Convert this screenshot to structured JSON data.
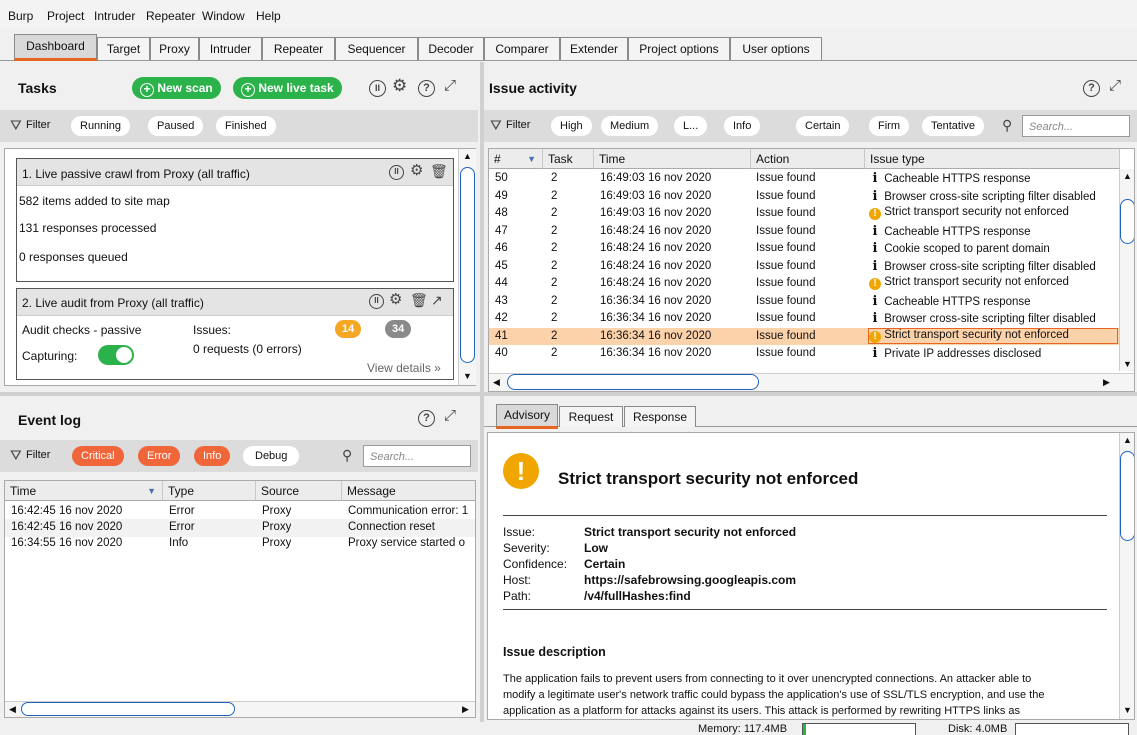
{
  "menu": [
    "Burp",
    "Project",
    "Intruder",
    "Repeater",
    "Window",
    "Help"
  ],
  "tabs": [
    "Dashboard",
    "Target",
    "Proxy",
    "Intruder",
    "Repeater",
    "Sequencer",
    "Decoder",
    "Comparer",
    "Extender",
    "Project options",
    "User options"
  ],
  "tasks": {
    "title": "Tasks",
    "new_scan": "New scan",
    "new_live_task": "New live task",
    "filter_label": "Filter",
    "filters": [
      "Running",
      "Paused",
      "Finished"
    ],
    "task1": {
      "title": "1. Live passive crawl from Proxy (all traffic)",
      "lines": [
        "582 items added to site map",
        "131 responses processed",
        "0 responses queued"
      ]
    },
    "task2": {
      "title": "2. Live audit from Proxy (all traffic)",
      "audit_checks": "Audit checks - passive",
      "issues_label": "Issues:",
      "issues_orange": "14",
      "issues_gray": "34",
      "requests": "0 requests (0 errors)",
      "capturing_label": "Capturing:",
      "view_details": "View details"
    }
  },
  "issue_activity": {
    "title": "Issue activity",
    "filter_label": "Filter",
    "filters": [
      "High",
      "Medium",
      "L...",
      "Info",
      "Certain",
      "Firm",
      "Tentative"
    ],
    "search_placeholder": "Search...",
    "columns": [
      "#",
      "Task",
      "Time",
      "Action",
      "Issue type"
    ],
    "rows": [
      {
        "num": "50",
        "task": "2",
        "time": "16:49:03 16 nov 2020",
        "action": "Issue found",
        "icon": "info",
        "type": "Cacheable HTTPS response"
      },
      {
        "num": "49",
        "task": "2",
        "time": "16:49:03 16 nov 2020",
        "action": "Issue found",
        "icon": "info",
        "type": "Browser cross-site scripting filter disabled"
      },
      {
        "num": "48",
        "task": "2",
        "time": "16:49:03 16 nov 2020",
        "action": "Issue found",
        "icon": "warn",
        "type": "Strict transport security not enforced"
      },
      {
        "num": "47",
        "task": "2",
        "time": "16:48:24 16 nov 2020",
        "action": "Issue found",
        "icon": "info",
        "type": "Cacheable HTTPS response"
      },
      {
        "num": "46",
        "task": "2",
        "time": "16:48:24 16 nov 2020",
        "action": "Issue found",
        "icon": "info",
        "type": "Cookie scoped to parent domain"
      },
      {
        "num": "45",
        "task": "2",
        "time": "16:48:24 16 nov 2020",
        "action": "Issue found",
        "icon": "info",
        "type": "Browser cross-site scripting filter disabled"
      },
      {
        "num": "44",
        "task": "2",
        "time": "16:48:24 16 nov 2020",
        "action": "Issue found",
        "icon": "warn",
        "type": "Strict transport security not enforced"
      },
      {
        "num": "43",
        "task": "2",
        "time": "16:36:34 16 nov 2020",
        "action": "Issue found",
        "icon": "info",
        "type": "Cacheable HTTPS response"
      },
      {
        "num": "42",
        "task": "2",
        "time": "16:36:34 16 nov 2020",
        "action": "Issue found",
        "icon": "info",
        "type": "Browser cross-site scripting filter disabled"
      },
      {
        "num": "41",
        "task": "2",
        "time": "16:36:34 16 nov 2020",
        "action": "Issue found",
        "icon": "warn",
        "type": "Strict transport security not enforced",
        "selected": true
      },
      {
        "num": "40",
        "task": "2",
        "time": "16:36:34 16 nov 2020",
        "action": "Issue found",
        "icon": "info",
        "type": "Private IP addresses disclosed"
      }
    ]
  },
  "event_log": {
    "title": "Event log",
    "filter_label": "Filter",
    "filters": [
      "Critical",
      "Error",
      "Info",
      "Debug"
    ],
    "search_placeholder": "Search...",
    "columns": [
      "Time",
      "Type",
      "Source",
      "Message"
    ],
    "rows": [
      {
        "time": "16:42:45 16 nov 2020",
        "type": "Error",
        "source": "Proxy",
        "message": "Communication error: 1"
      },
      {
        "time": "16:42:45 16 nov 2020",
        "type": "Error",
        "source": "Proxy",
        "message": "Connection reset"
      },
      {
        "time": "16:34:55 16 nov 2020",
        "type": "Info",
        "source": "Proxy",
        "message": "Proxy service started o"
      }
    ]
  },
  "advisory": {
    "tabs": [
      "Advisory",
      "Request",
      "Response"
    ],
    "heading": "Strict transport security not enforced",
    "fields": [
      {
        "label": "Issue:",
        "value": "Strict transport security not enforced"
      },
      {
        "label": "Severity:",
        "value": "Low"
      },
      {
        "label": "Confidence:",
        "value": "Certain"
      },
      {
        "label": "Host:",
        "value": "https://safebrowsing.googleapis.com"
      },
      {
        "label": "Path:",
        "value": "/v4/fullHashes:find"
      }
    ],
    "section_title": "Issue description",
    "description_lines": [
      "The application fails to prevent users from connecting to it over unencrypted connections. An attacker able to",
      "modify a legitimate user's network traffic could bypass the application's use of SSL/TLS encryption, and use the",
      "application as a platform for attacks against its users. This attack is performed by rewriting HTTPS links as"
    ]
  },
  "status": {
    "memory": "Memory: 117.4MB",
    "memory_fraction": 0.03,
    "disk": "Disk: 4.0MB",
    "disk_fraction": 0.0
  },
  "colors": {
    "accent": "#e8651f",
    "green": "#2cb24b",
    "orange": "#f0663a",
    "selected_row": "#fbd2a9",
    "warn": "#f0a500",
    "scroll_blue": "#1f63c2"
  }
}
